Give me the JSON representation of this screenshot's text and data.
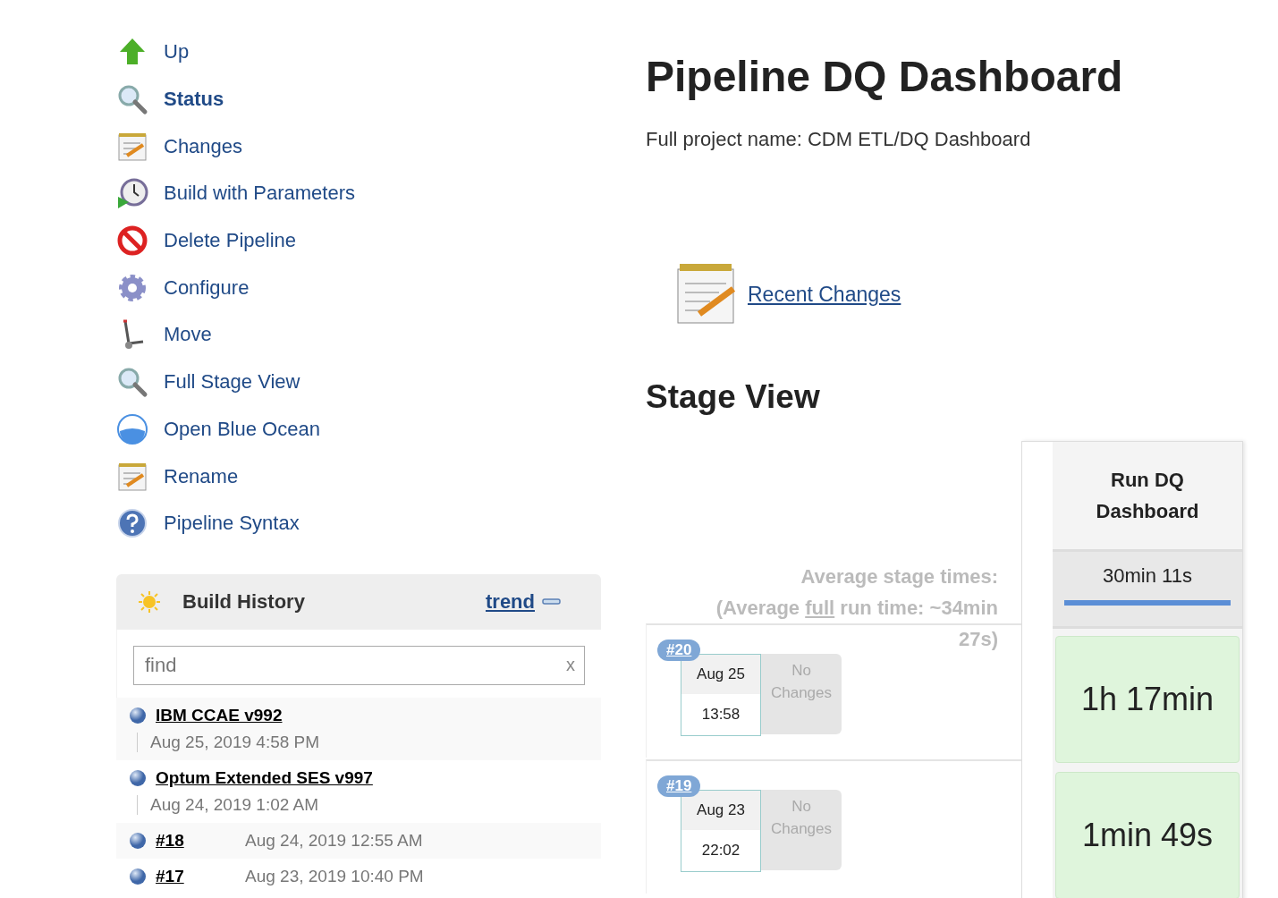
{
  "sidebar": {
    "items": [
      {
        "label": "Up",
        "kind": "arrow",
        "selected": false
      },
      {
        "label": "Status",
        "kind": "magnifier",
        "selected": true
      },
      {
        "label": "Changes",
        "kind": "notepad",
        "selected": false
      },
      {
        "label": "Build with Parameters",
        "kind": "clock",
        "selected": false
      },
      {
        "label": "Delete Pipeline",
        "kind": "prohibition",
        "selected": false
      },
      {
        "label": "Configure",
        "kind": "gear",
        "selected": false
      },
      {
        "label": "Move",
        "kind": "dolly",
        "selected": false
      },
      {
        "label": "Full Stage View",
        "kind": "magnifier",
        "selected": false
      },
      {
        "label": "Open Blue Ocean",
        "kind": "ocean",
        "selected": false
      },
      {
        "label": "Rename",
        "kind": "notepad",
        "selected": false
      },
      {
        "label": "Pipeline Syntax",
        "kind": "help",
        "selected": false
      }
    ]
  },
  "build_history": {
    "title": "Build History",
    "trend": "trend",
    "search": {
      "placeholder": "find",
      "clear": "x"
    },
    "builds": [
      {
        "kind": "named",
        "name": "IBM CCAE v992",
        "date": "Aug 25, 2019 4:58 PM"
      },
      {
        "kind": "named",
        "name": "Optum Extended SES v997",
        "date": "Aug 24, 2019 1:02 AM"
      },
      {
        "kind": "number",
        "name": "#18",
        "date": "Aug 24, 2019 12:55 AM"
      },
      {
        "kind": "number",
        "name": "#17",
        "date": "Aug 23, 2019 10:40 PM"
      }
    ]
  },
  "main": {
    "title": "Pipeline DQ Dashboard",
    "full_name": "Full project name: CDM ETL/DQ Dashboard",
    "recent_changes": "Recent Changes"
  },
  "stage_view": {
    "title": "Stage View",
    "avg_label": "Average stage times:",
    "avg_prefix": "(Average ",
    "avg_link": "full",
    "avg_suffix": " run time: ~34min 27s)",
    "stage": {
      "name": "Run DQ Dashboard",
      "average": "30min 11s"
    },
    "runs": [
      {
        "badge": "#20",
        "date": "Aug 25",
        "time": "13:58",
        "changes": "No Changes",
        "duration": "1h 17min"
      },
      {
        "badge": "#19",
        "date": "Aug 23",
        "time": "22:02",
        "changes": "No Changes",
        "duration": "1min 49s"
      }
    ]
  }
}
